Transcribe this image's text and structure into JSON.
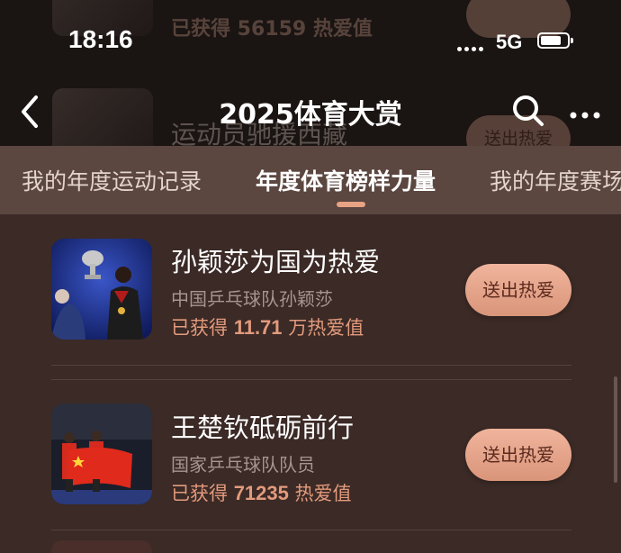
{
  "background_items": [
    {
      "title": "",
      "stat": "已获得 56159 热爱值"
    },
    {
      "title": "运动员驰援西藏",
      "button": "送出热爱"
    }
  ],
  "status_bar": {
    "time": "18:16",
    "network": "5G",
    "battery_level": 0.75
  },
  "nav": {
    "title": "2025体育大赏",
    "back_icon": "chevron-left-icon",
    "search_icon": "search-icon",
    "more_icon": "more-horizontal-icon"
  },
  "tabs": [
    {
      "label": "我的年度运动记录"
    },
    {
      "label": "年度体育榜样力量",
      "active": true
    },
    {
      "label": "我的年度赛场"
    }
  ],
  "items": [
    {
      "title": "孙颖莎为国为热爱",
      "subtitle": "中国乒乓球队孙颖莎",
      "stat_prefix": "已获得 ",
      "stat_value": "11.71",
      "stat_suffix": " 万热爱值",
      "button": "送出热爱"
    },
    {
      "title": "王楚钦砥砺前行",
      "subtitle": "国家乒乓球队队员",
      "stat_prefix": "已获得 ",
      "stat_value": "71235",
      "stat_suffix": " 热爱值",
      "button": "送出热爱"
    }
  ],
  "colors": {
    "accent": "#e39a7c",
    "button_bg": "#e6a489",
    "page_bg": "#3b2a26",
    "tab_bg": "#5b4640"
  }
}
